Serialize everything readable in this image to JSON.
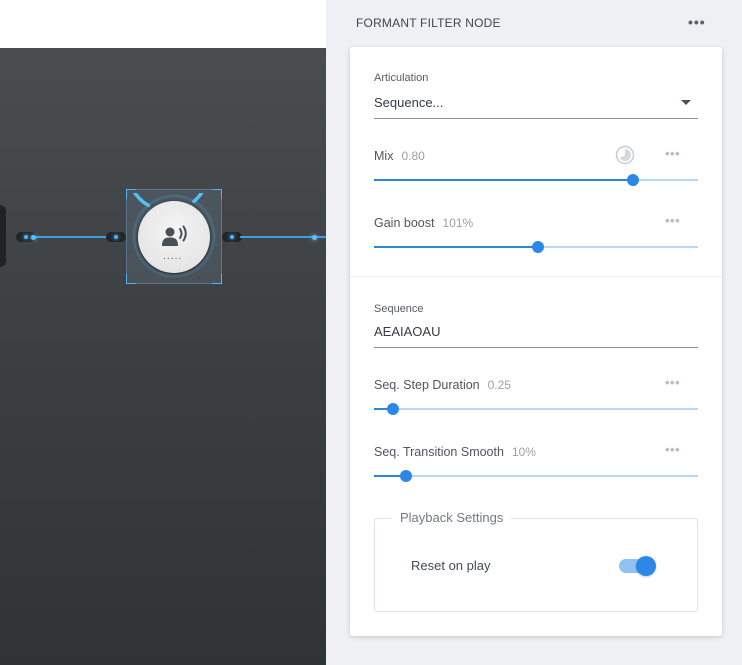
{
  "panel": {
    "title": "FORMANT FILTER NODE",
    "menu_icon": "more-horizontal-icon"
  },
  "articulation": {
    "label": "Articulation",
    "value": "Sequence...",
    "dropdown_icon": "caret-down-icon"
  },
  "mix": {
    "label": "Mix",
    "value": "0.80",
    "level": 0.8
  },
  "gain_boost": {
    "label": "Gain boost",
    "value": "101%",
    "level": 0.505
  },
  "sequence": {
    "label": "Sequence",
    "value": "AEAIAOAU"
  },
  "seq_step_duration": {
    "label": "Seq. Step Duration",
    "value": "0.25",
    "level": 0.06
  },
  "seq_transition_smooth": {
    "label": "Seq. Transition Smooth",
    "value": "10%",
    "level": 0.1
  },
  "playback": {
    "title": "Playback Settings",
    "reset_on_play": {
      "label": "Reset on play",
      "enabled": true
    }
  },
  "node": {
    "icon": "voice-speaker-icon",
    "dots": "....."
  },
  "colors": {
    "accent": "#2b87e8",
    "track": "#b6d7f5",
    "wire": "#3e9be0"
  }
}
